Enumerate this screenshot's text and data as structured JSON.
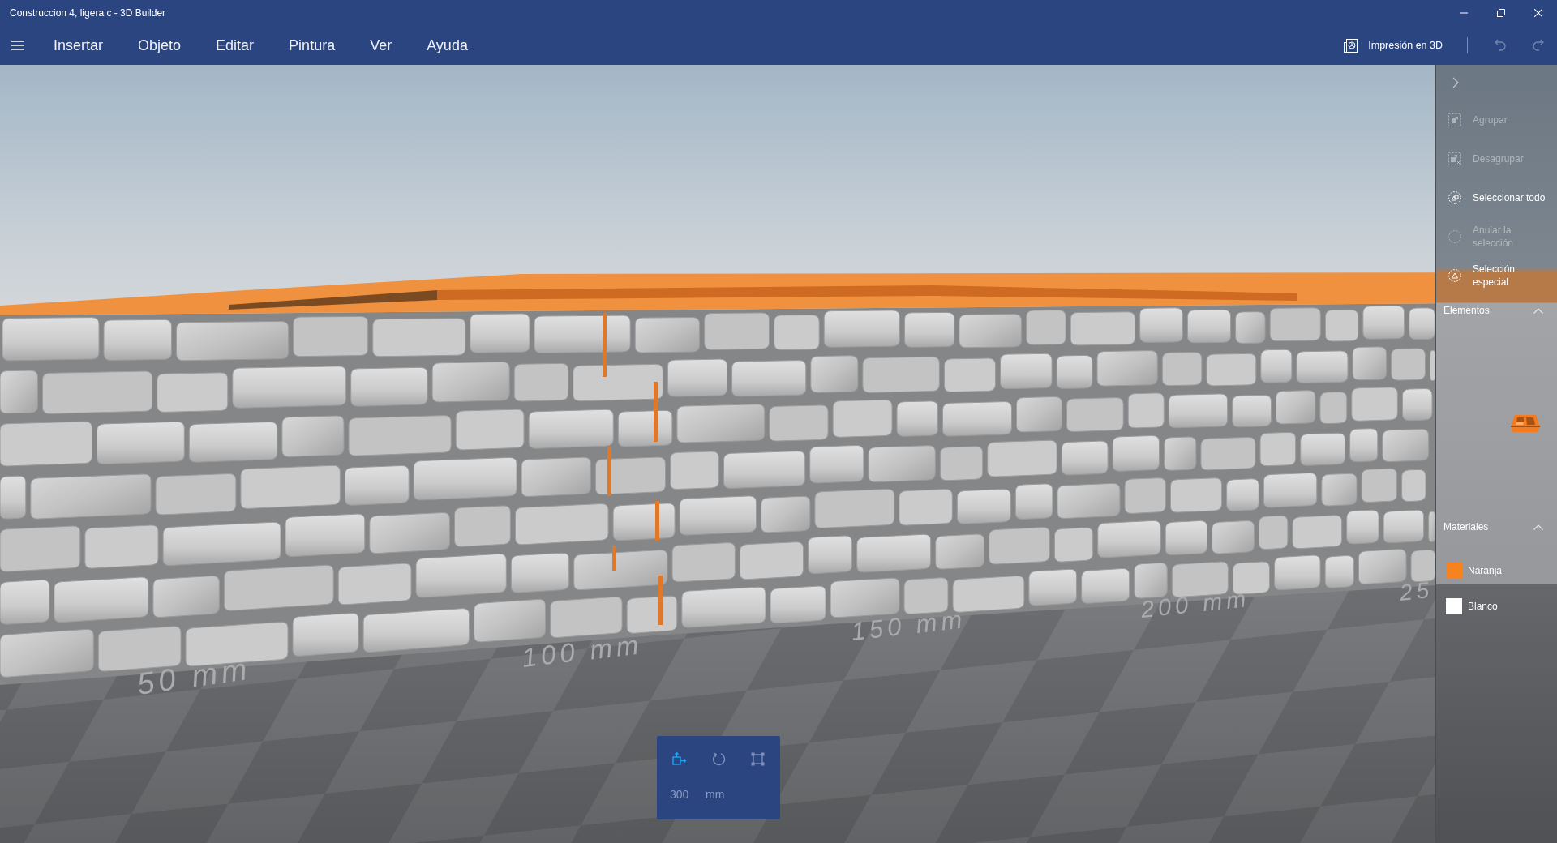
{
  "window": {
    "title": "Construccion 4, ligera c - 3D Builder"
  },
  "menu": {
    "items": [
      "Insertar",
      "Objeto",
      "Editar",
      "Pintura",
      "Ver",
      "Ayuda"
    ]
  },
  "toolbar": {
    "print_button": "Impresión en 3D",
    "undo": {
      "disabled": true
    },
    "redo": {
      "disabled": true
    }
  },
  "viewport": {
    "ruler_labels": [
      "50 mm",
      "100 mm",
      "150 mm",
      "200 mm",
      "25"
    ]
  },
  "side_panel": {
    "actions": [
      {
        "kind": "group",
        "label": "Agrupar",
        "disabled": true
      },
      {
        "kind": "ungroup",
        "label": "Desagrupar",
        "disabled": true
      },
      {
        "kind": "select_all",
        "label": "Seleccionar todo",
        "disabled": false
      },
      {
        "kind": "deselect",
        "label": "Anular la selección",
        "disabled": true
      },
      {
        "kind": "special_select",
        "label": "Selección especial",
        "disabled": false
      }
    ],
    "sections": [
      {
        "kind": "elements",
        "title": "Elementos",
        "expanded": true
      },
      {
        "kind": "materials",
        "title": "Materiales",
        "expanded": true,
        "materials": [
          {
            "name": "Naranja",
            "color": "#f7821e"
          },
          {
            "name": "Blanco",
            "color": "#ffffff"
          }
        ]
      }
    ]
  },
  "transform_tool": {
    "tools": [
      {
        "kind": "move",
        "selected": true
      },
      {
        "kind": "rotate",
        "selected": false
      },
      {
        "kind": "scale",
        "selected": false
      }
    ],
    "value": "300",
    "unit": "mm"
  }
}
